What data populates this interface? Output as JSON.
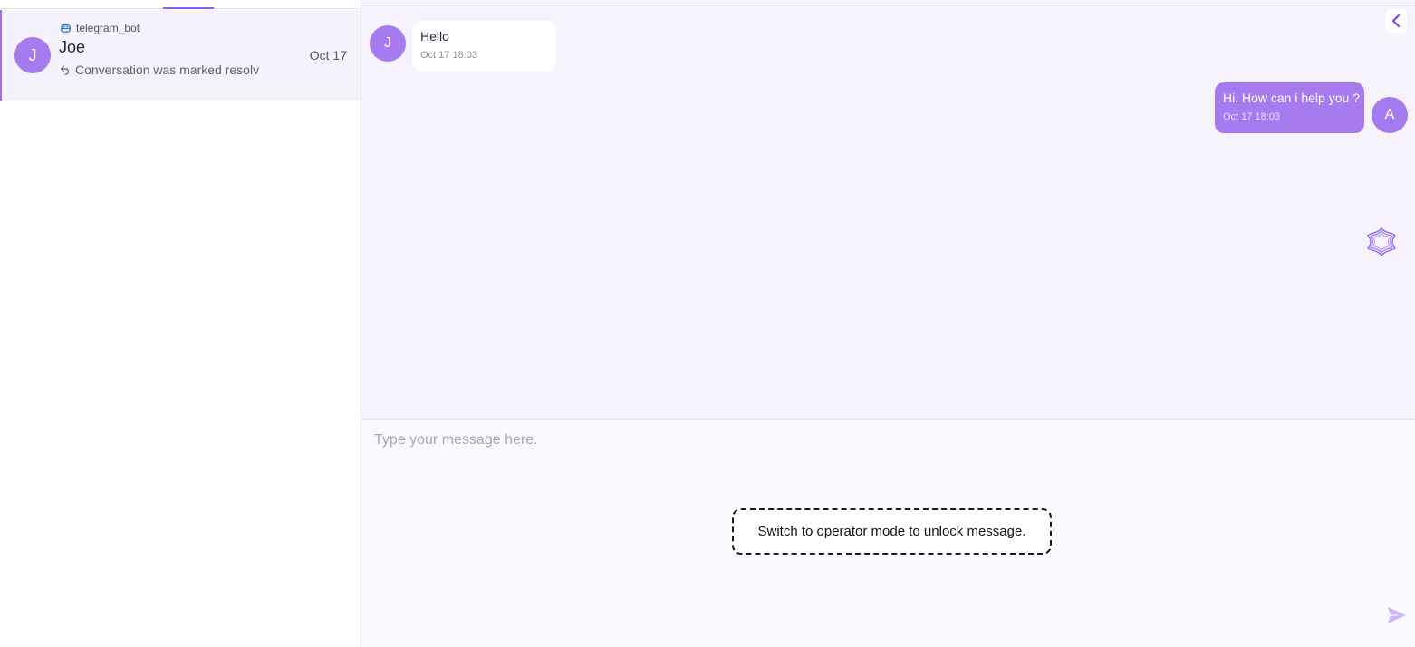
{
  "conversation_list": {
    "items": [
      {
        "source": "telegram_bot",
        "avatar_initial": "J",
        "name": "Joe",
        "last_message": "Conversation was marked resolv",
        "date": "Oct 17"
      }
    ]
  },
  "chat": {
    "messages": [
      {
        "direction": "incoming",
        "avatar_initial": "J",
        "text": "Hello",
        "time": "Oct 17 18:03"
      },
      {
        "direction": "outgoing",
        "avatar_initial": "A",
        "text": "Hi. How can i help you ?",
        "time": "Oct 17 18:03"
      }
    ]
  },
  "composer": {
    "placeholder": "Type your message here.",
    "operator_notice": "Switch to operator mode to unlock message."
  },
  "icons": {
    "source": "bot-icon",
    "last_message": "reply-icon",
    "collapse": "chevron-left-icon",
    "assistant": "ai-assistant-icon",
    "send": "send-icon"
  },
  "colors": {
    "accent": "#a57bef",
    "active_tab": "#8b5cf6",
    "chat_background": "#f6f3fc"
  }
}
